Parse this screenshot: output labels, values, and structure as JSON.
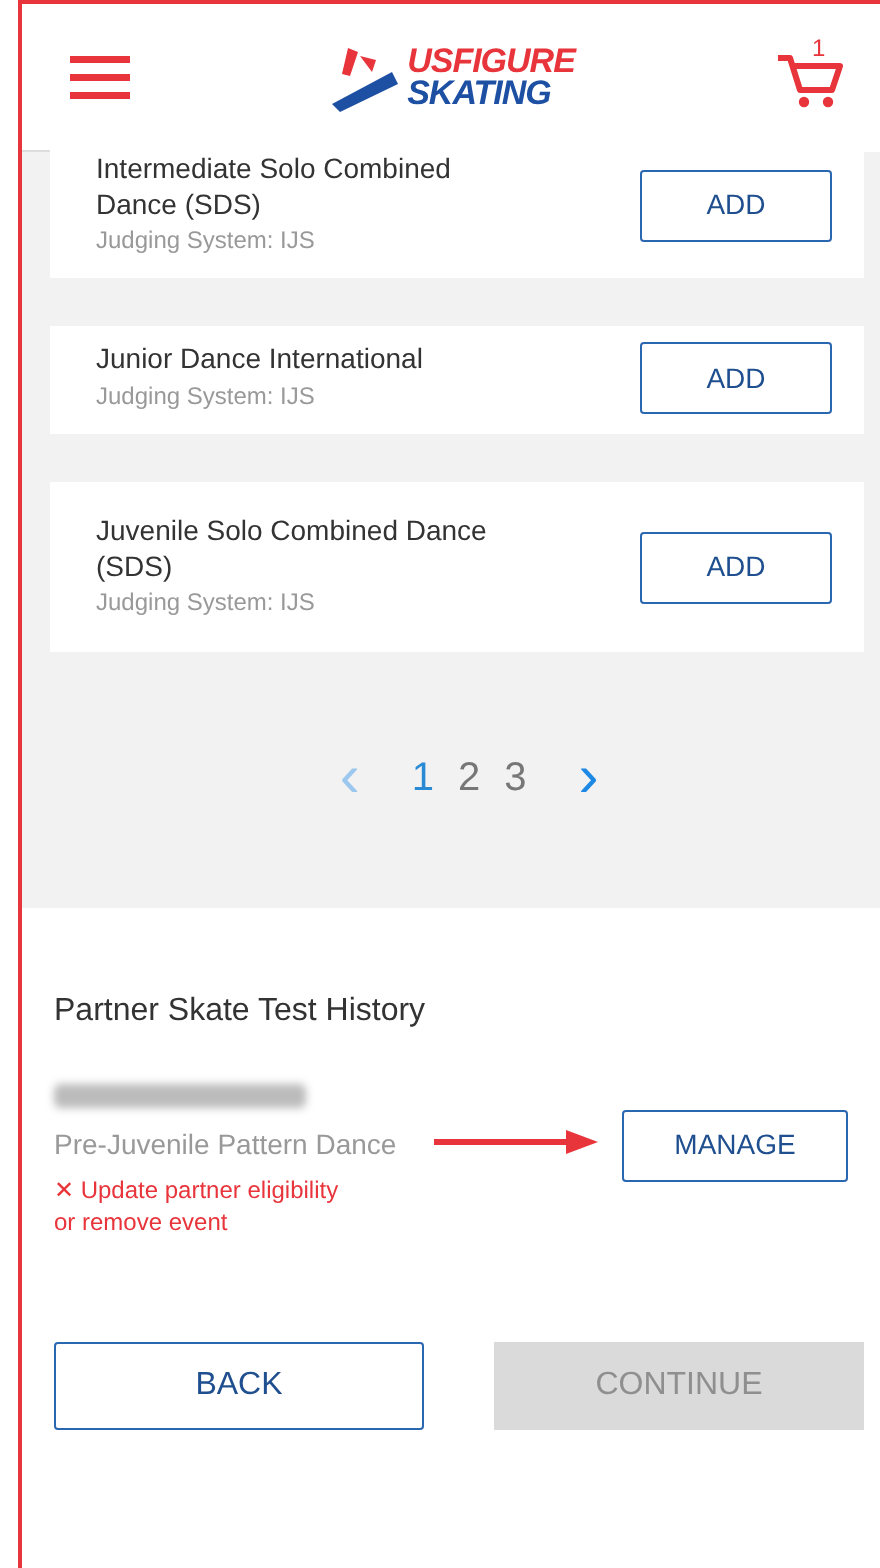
{
  "header": {
    "logo": {
      "line_1": "USFIGURE",
      "line_2": "SKATING"
    },
    "cart": {
      "count": "1"
    }
  },
  "events": [
    {
      "name": "Intermediate Solo Combined Dance (SDS)",
      "judging": "Judging System: IJS",
      "button": "ADD"
    },
    {
      "name": "Junior Dance International",
      "judging": "Judging System: IJS",
      "button": "ADD"
    },
    {
      "name": "Juvenile Solo Combined Dance (SDS)",
      "judging": "Judging System: IJS",
      "button": "ADD"
    }
  ],
  "pagination": {
    "prev": {
      "label": "‹",
      "disabled": true
    },
    "pages": [
      {
        "label": "1",
        "selected": true
      },
      {
        "label": "2",
        "selected": false
      },
      {
        "label": "3",
        "selected": false
      }
    ],
    "next": {
      "label": "›",
      "disabled": false
    }
  },
  "partner": {
    "title": "Partner Skate Test History",
    "event": "Pre-Juvenile Pattern Dance",
    "error_icon": "✕",
    "error": "Update partner eligibility or remove event",
    "button": "MANAGE"
  },
  "footer": {
    "back": {
      "label": "BACK",
      "disabled": false
    },
    "continue": {
      "label": "CONTINUE",
      "disabled": true
    }
  }
}
